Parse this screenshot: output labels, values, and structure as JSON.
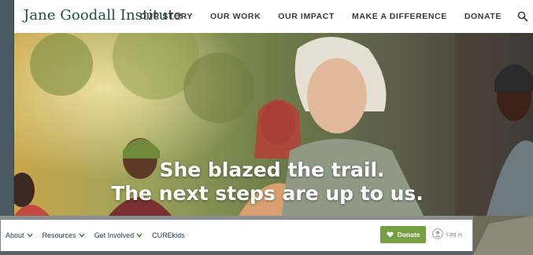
{
  "site": {
    "logo": "Jane Goodall Institute",
    "nav": [
      "OUR STORY",
      "OUR WORK",
      "OUR IMPACT",
      "MAKE A DIFFERENCE",
      "DONATE"
    ],
    "search_icon": "search-icon"
  },
  "hero": {
    "line1": "She blazed the trail.",
    "line2": "The next steps are up to us."
  },
  "subnav": {
    "items": [
      {
        "label": "About",
        "dropdown": true
      },
      {
        "label": "Resources",
        "dropdown": true
      },
      {
        "label": "Get Involved",
        "dropdown": true
      },
      {
        "label": "CUREkids",
        "dropdown": false
      }
    ],
    "donate_label": "Donate",
    "login_label": "Log in"
  },
  "colors": {
    "logo": "#1f4d45",
    "donate_bg": "#76a043",
    "nav_text": "#3a3a3a"
  }
}
